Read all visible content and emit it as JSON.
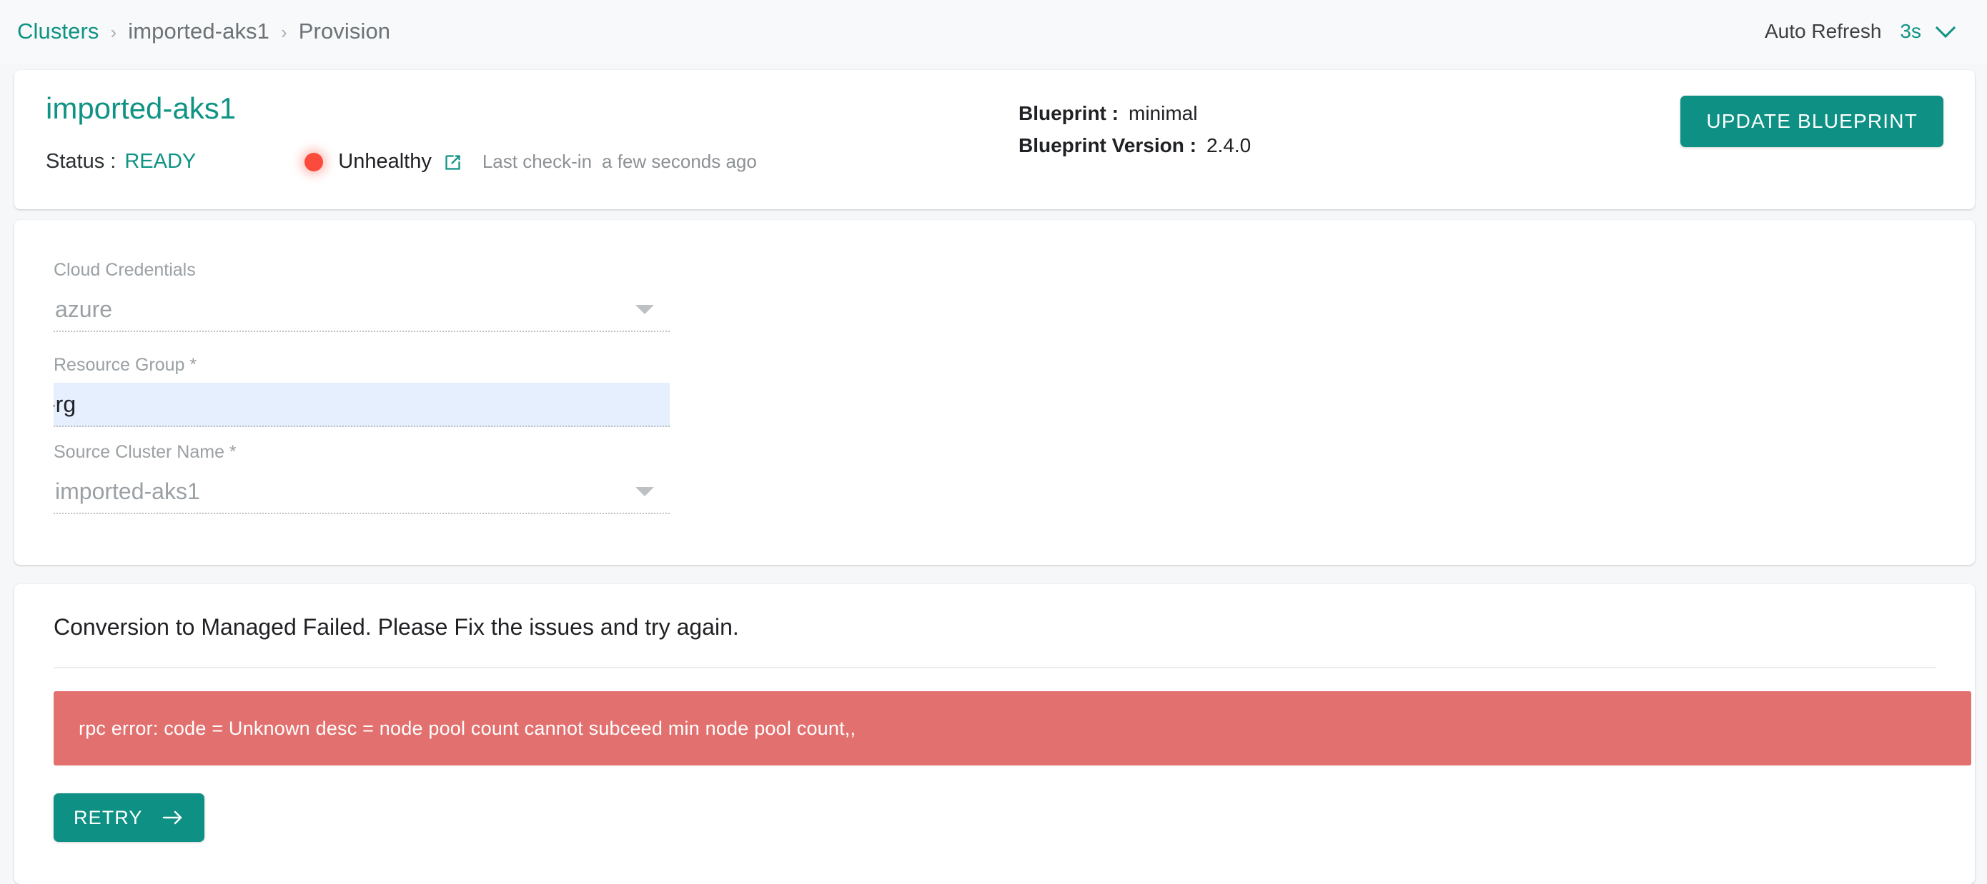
{
  "topbar": {
    "breadcrumb": [
      {
        "label": "Clusters",
        "type": "link"
      },
      {
        "label": "imported-aks1",
        "type": "plain"
      },
      {
        "label": "Provision",
        "type": "plain"
      }
    ],
    "separator": "›",
    "auto_refresh": {
      "label": "Auto Refresh",
      "value": "3s",
      "chevron_icon": "chevron-down-icon"
    }
  },
  "header": {
    "cluster_name": "imported-aks1",
    "status_label": "Status :",
    "status_value": "READY",
    "health_indicator": "status-dot-icon",
    "health_text": "Unhealthy",
    "external_link_icon": "external-link-icon",
    "last_checkin_label": "Last check-in",
    "last_checkin_value": "a few seconds ago",
    "blueprint_key": "Blueprint :",
    "blueprint_value": "minimal",
    "blueprint_version_key": "Blueprint Version :",
    "blueprint_version_value": "2.4.0",
    "update_button": "UPDATE BLUEPRINT"
  },
  "form": {
    "fields": [
      {
        "label": "Cloud Credentials",
        "value": "azure",
        "control": "select",
        "disabled": true
      },
      {
        "label": "Resource Group *",
        "value": "-rg",
        "control": "text",
        "disabled": false
      },
      {
        "label": "Source Cluster Name *",
        "value": "imported-aks1",
        "control": "select",
        "disabled": true
      }
    ]
  },
  "failure": {
    "title": "Conversion to Managed Failed. Please Fix the issues and try again.",
    "error_message": "rpc error: code = Unknown desc = node pool count cannot subceed min node pool count,,",
    "retry_button": "RETRY",
    "retry_icon": "arrow-right-icon"
  },
  "colors": {
    "accent_teal": "#0E9184",
    "error_red": "#E2706E",
    "status_dot_red": "#FA4B3C",
    "page_bg": "#F5F7F9",
    "autofill_blue": "#E6EFFD"
  }
}
